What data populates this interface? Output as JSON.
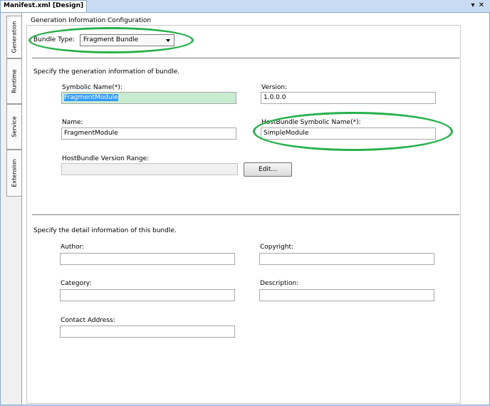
{
  "tab": {
    "title": "Manifest.xml [Design]",
    "dropdown_glyph": "▾",
    "close_glyph": "✕"
  },
  "side_tabs": [
    "Generation",
    "Runtime",
    "Service",
    "Extension"
  ],
  "group_title": "Generation Information Configuration",
  "bundle_type": {
    "label": "Bundle Type:",
    "value": "Fragment Bundle"
  },
  "generation": {
    "instruction": "Specify the generation information of bundle.",
    "symbolic_name": {
      "label": "Symbolic Name(*):",
      "value": "FragmentModule"
    },
    "version": {
      "label": "Version:",
      "value": "1.0.0.0"
    },
    "name": {
      "label": "Name:",
      "value": "FragmentModule"
    },
    "host_symbolic": {
      "label": "HostBundle Symbolic Name(*):",
      "value": "SimpleModule"
    },
    "host_version": {
      "label": "HostBundle Version Range:",
      "value": ""
    },
    "edit_label": "Edit..."
  },
  "detail": {
    "instruction": "Specify the detail information of this bundle.",
    "author": {
      "label": "Author:",
      "value": ""
    },
    "copyright": {
      "label": "Copyright:",
      "value": ""
    },
    "category": {
      "label": "Category:",
      "value": ""
    },
    "description": {
      "label": "Description:",
      "value": ""
    },
    "contact": {
      "label": "Contact Address:",
      "value": ""
    }
  },
  "colors": {
    "highlight_ellipse": "#28b04c",
    "selection": "#3399ff"
  }
}
